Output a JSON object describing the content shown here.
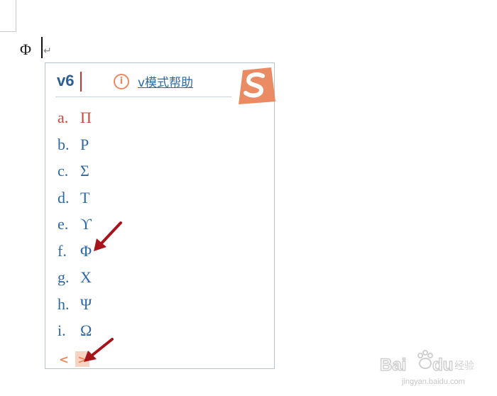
{
  "document": {
    "typed_symbol": "Φ",
    "paragraph_mark": "↵"
  },
  "ime": {
    "input_text": "v6",
    "help_icon": "info-icon",
    "help_link": "v模式帮助",
    "logo": "sogou-s-logo",
    "candidates": [
      {
        "label": "a.",
        "symbol": "Π",
        "active": true
      },
      {
        "label": "b.",
        "symbol": "Ρ",
        "active": false
      },
      {
        "label": "c.",
        "symbol": "Σ",
        "active": false
      },
      {
        "label": "d.",
        "symbol": "Τ",
        "active": false
      },
      {
        "label": "e.",
        "symbol": "ϒ",
        "active": false
      },
      {
        "label": "f.",
        "symbol": "Φ",
        "active": false
      },
      {
        "label": "g.",
        "symbol": "Χ",
        "active": false
      },
      {
        "label": "h.",
        "symbol": "Ψ",
        "active": false
      },
      {
        "label": "i.",
        "symbol": "Ω",
        "active": false
      }
    ],
    "pager": {
      "prev": "<",
      "next": ">"
    }
  },
  "annotations": {
    "arrow_color": "#a8141b"
  },
  "watermark": {
    "logo_text": "Baidu经验",
    "url": "jingyan.baidu.com"
  },
  "colors": {
    "accent_orange": "#e9875d",
    "link_blue": "#2e69a8",
    "active_red": "#c8453a"
  }
}
